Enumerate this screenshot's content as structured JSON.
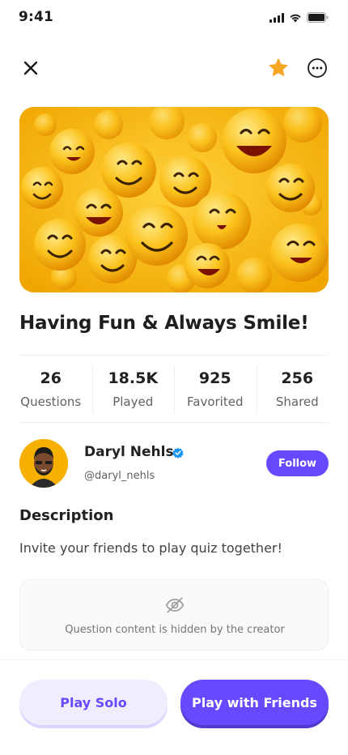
{
  "status_bar": {
    "time": "9:41"
  },
  "top_nav": {
    "close_icon": "close-icon",
    "favorite_icon": "star-icon",
    "more_icon": "more-horizontal-circle-icon",
    "favorite_color": "#F6A623"
  },
  "cover": {
    "description_icon": "emoji-smiley-collage"
  },
  "quiz": {
    "title": "Having Fun & Always Smile!"
  },
  "stats": [
    {
      "value": "26",
      "label": "Questions"
    },
    {
      "value": "18.5K",
      "label": "Played"
    },
    {
      "value": "925",
      "label": "Favorited"
    },
    {
      "value": "256",
      "label": "Shared"
    }
  ],
  "author": {
    "name": "Daryl Nehls",
    "handle": "@daryl_nehls",
    "follow_label": "Follow",
    "verified_icon": "verified-badge-icon"
  },
  "description": {
    "heading": "Description",
    "text": "Invite your friends to play quiz together!"
  },
  "hidden_notice": {
    "icon": "eye-off-icon",
    "text": "Question content is hidden by the creator"
  },
  "actions": {
    "solo_label": "Play Solo",
    "friends_label": "Play with Friends"
  },
  "colors": {
    "primary": "#6949FF",
    "primary_light": "#F0EDFF",
    "text_dark": "#212121",
    "text_muted": "#616161"
  }
}
